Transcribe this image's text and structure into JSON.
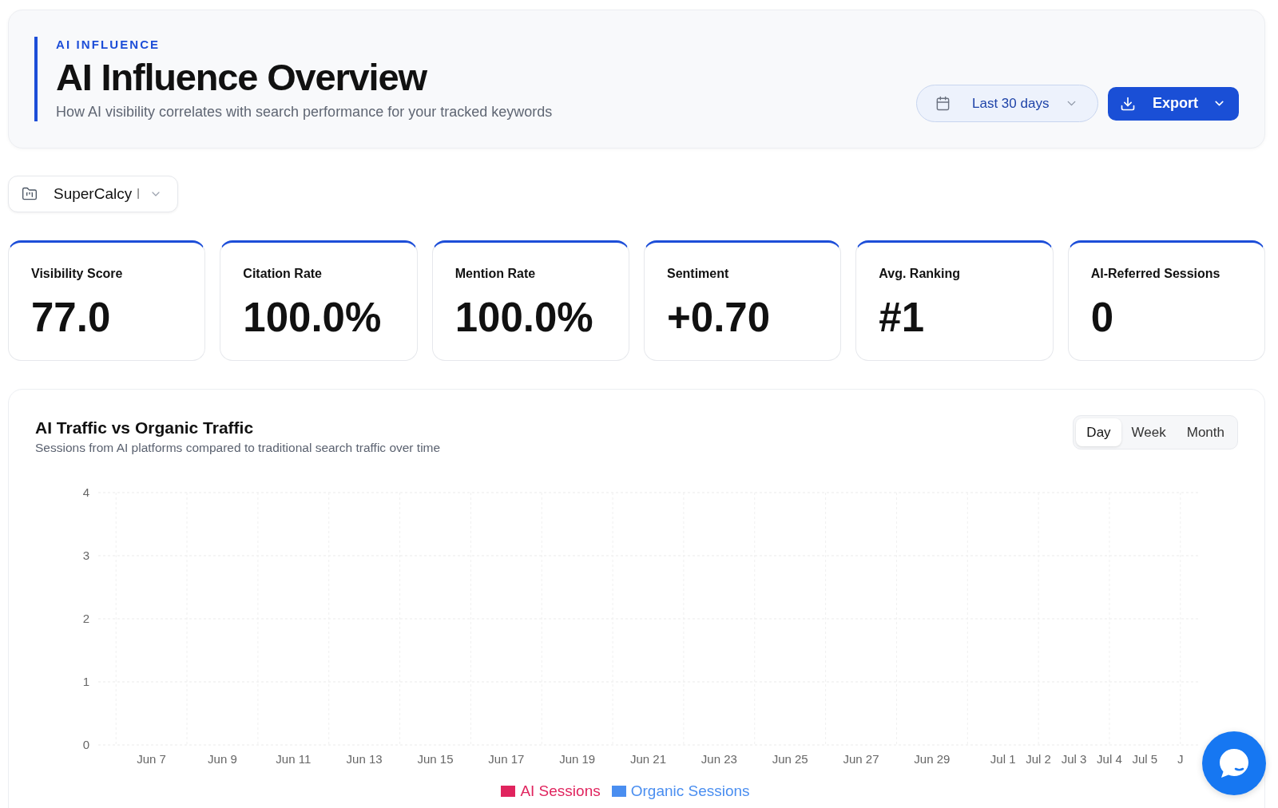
{
  "header": {
    "eyebrow": "AI INFLUENCE",
    "title": "AI Influence Overview",
    "subtitle": "How AI visibility correlates with search performance for your tracked keywords",
    "date_range": {
      "label": "Last 30 days"
    },
    "export_button": {
      "label": "Export"
    }
  },
  "project_selector": {
    "value": "SuperCalcy I"
  },
  "metrics": [
    {
      "label": "Visibility Score",
      "value": "77.0"
    },
    {
      "label": "Citation Rate",
      "value": "100.0%"
    },
    {
      "label": "Mention Rate",
      "value": "100.0%"
    },
    {
      "label": "Sentiment",
      "value": "+0.70"
    },
    {
      "label": "Avg. Ranking",
      "value": "#1"
    },
    {
      "label": "AI-Referred Sessions",
      "value": "0"
    }
  ],
  "traffic_chart": {
    "title": "AI Traffic vs Organic Traffic",
    "subtitle": "Sessions from AI platforms compared to traditional search traffic over time",
    "granularity": [
      {
        "label": "Day",
        "selected": true
      },
      {
        "label": "Week",
        "selected": false
      },
      {
        "label": "Month",
        "selected": false
      }
    ],
    "chart_data": {
      "type": "bar",
      "grid": true,
      "categories": [
        null,
        "Jun 7",
        null,
        "Jun 9",
        null,
        "Jun 11",
        null,
        "Jun 13",
        null,
        "Jun 15",
        null,
        "Jun 17",
        null,
        "Jun 19",
        null,
        "Jun 21",
        null,
        "Jun 23",
        null,
        "Jun 25",
        null,
        "Jun 27",
        null,
        "Jun 29",
        null,
        "Jul 1",
        "Jul 2",
        "Jul 3",
        "Jul 4",
        "Jul 5",
        "J"
      ],
      "ylim": [
        0,
        4
      ],
      "yticks": [
        0,
        1,
        2,
        3,
        4
      ],
      "series": [
        {
          "name": "AI Sessions",
          "color": "#e0245e",
          "values": [
            0,
            0,
            0,
            0,
            0,
            0,
            0,
            0,
            0,
            0,
            0,
            0,
            0,
            0,
            0,
            0,
            0,
            0,
            0,
            0,
            0,
            0,
            0,
            0,
            0,
            0,
            0,
            0,
            0,
            0,
            0
          ]
        },
        {
          "name": "Organic Sessions",
          "color": "#4a8ef0",
          "values": [
            0,
            0,
            0,
            0,
            0,
            0,
            0,
            0,
            0,
            0,
            0,
            0,
            0,
            0,
            0,
            0,
            0,
            0,
            0,
            0,
            0,
            0,
            0,
            0,
            0,
            0,
            0,
            0,
            0,
            0,
            0
          ]
        }
      ]
    }
  }
}
